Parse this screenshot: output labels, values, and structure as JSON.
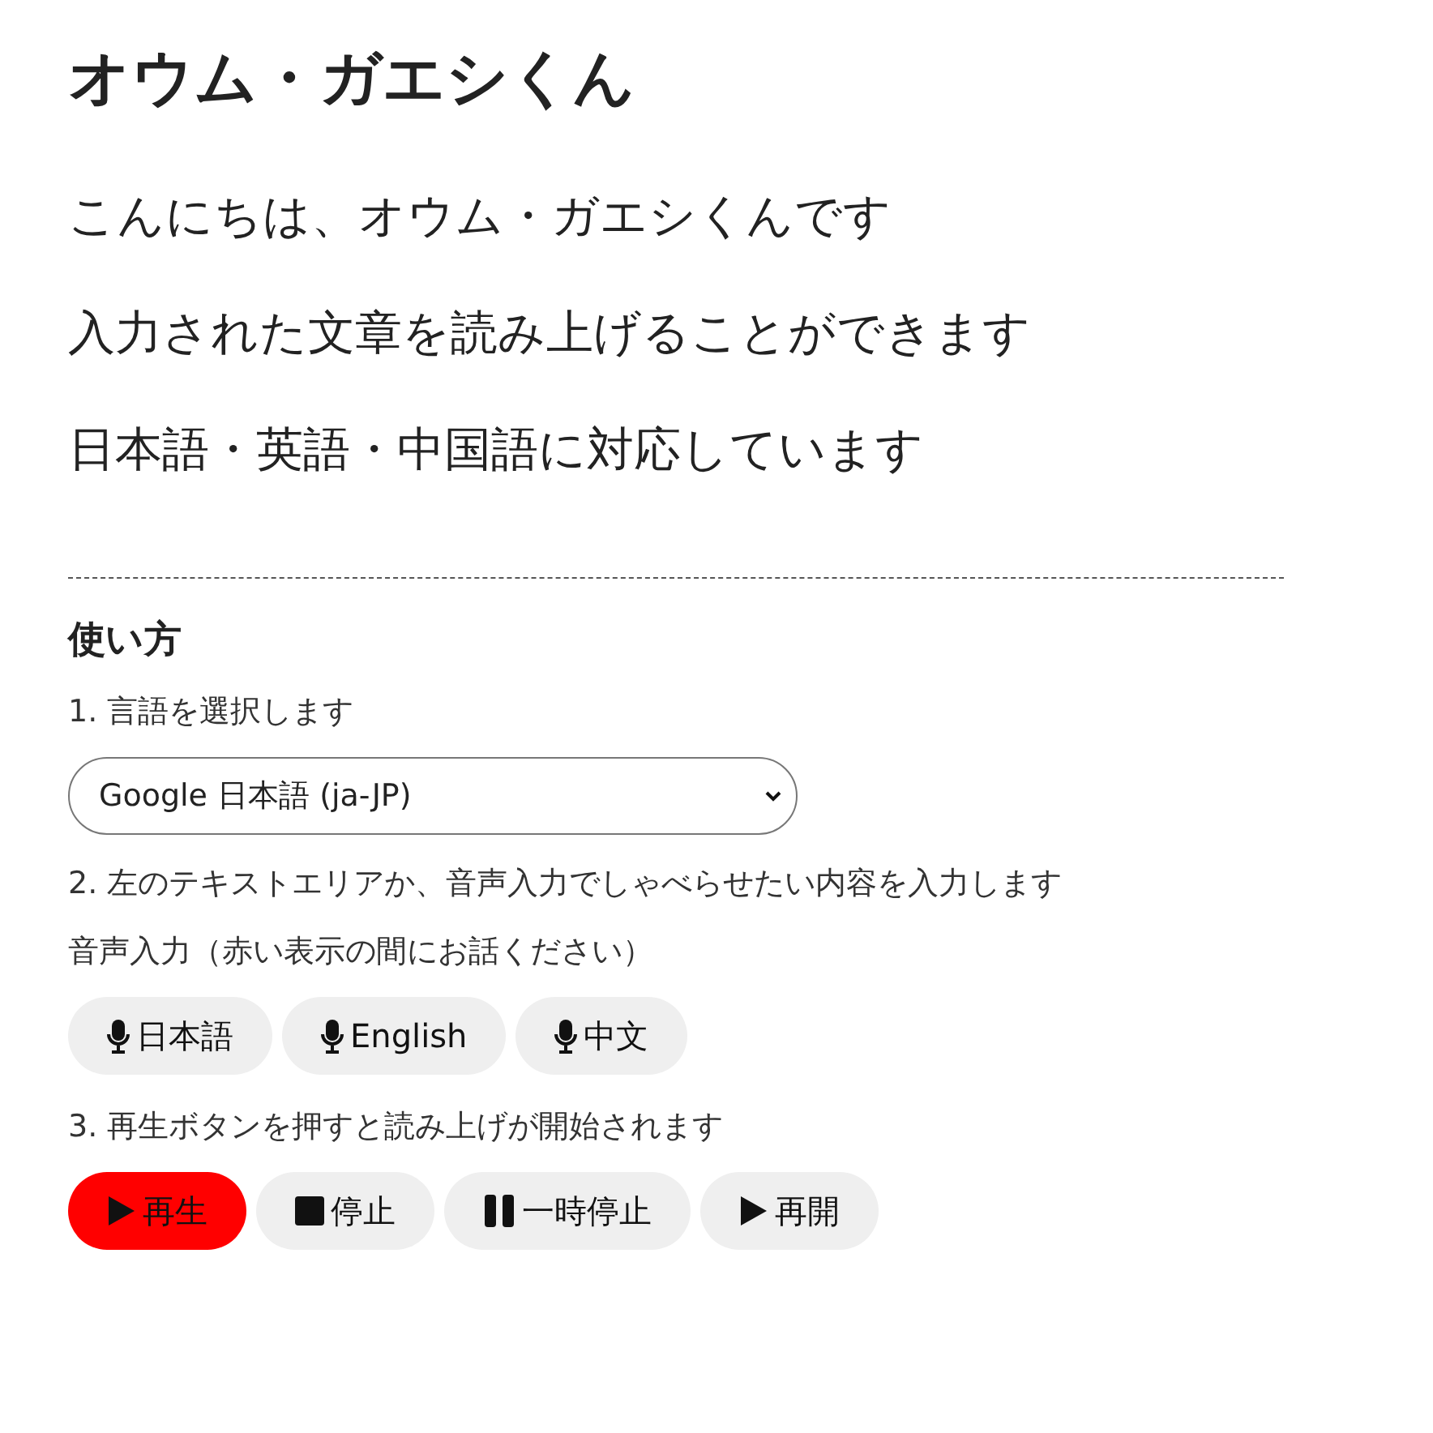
{
  "title": "オウム・ガエシくん",
  "intro": [
    "こんにちは、オウム・ガエシくんです",
    "入力された文章を読み上げることができます",
    "日本語・英語・中国語に対応しています"
  ],
  "howto": {
    "heading": "使い方",
    "step1": "1. 言語を選択します",
    "language_select": {
      "value": "Google 日本語 (ja-JP)"
    },
    "step2": "2. 左のテキストエリアか、音声入力でしゃべらせたい内容を入力します",
    "voice_input_label": "音声入力（赤い表示の間にお話ください）",
    "voice_buttons": [
      {
        "label": "日本語"
      },
      {
        "label": "English"
      },
      {
        "label": "中文"
      }
    ],
    "step3": "3. 再生ボタンを押すと読み上げが開始されます",
    "playback_buttons": [
      {
        "kind": "play",
        "label": "再生",
        "selected": true
      },
      {
        "kind": "stop",
        "label": "停止",
        "selected": false
      },
      {
        "kind": "pause",
        "label": "一時停止",
        "selected": false
      },
      {
        "kind": "play",
        "label": "再開",
        "selected": false
      }
    ]
  }
}
